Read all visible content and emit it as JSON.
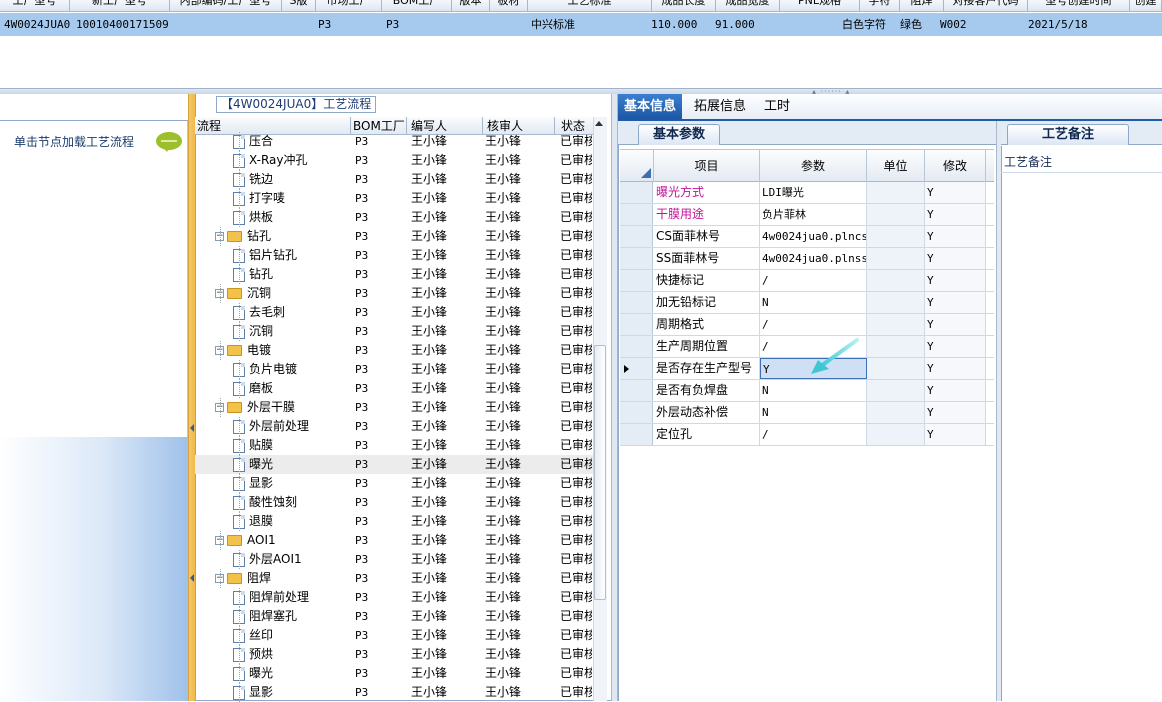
{
  "top_grid": {
    "headers": [
      "工厂型号",
      "新工厂型号",
      "内部编码/工厂型号",
      "S版",
      "市场工厂",
      "BOM工厂",
      "版本",
      "板材",
      "工艺标准",
      "成品长度",
      "成品宽度",
      "PNL规格",
      "字符",
      "阻焊",
      "对接客户代码",
      "型号创建时间",
      "创建"
    ],
    "row": {
      "model": "4W0024JUA0",
      "code": "10010400171509",
      "s_factory": "P3",
      "bom_factory": "P3",
      "standard": "中兴标准",
      "length": "110.000",
      "width": "91.000",
      "char": "白色字符",
      "mask": "绿色",
      "customer": "W002",
      "created": "2021/5/18"
    }
  },
  "left_panel": {
    "tip": "单击节点加载工艺流程",
    "tip_icon": "speech-bubble-icon"
  },
  "flow": {
    "group_title": "【4W0024JUA0】工艺流程",
    "columns": [
      "流程",
      "BOM工厂",
      "编写人",
      "核审人",
      "状态"
    ],
    "rows": [
      {
        "level": 2,
        "type": "file",
        "name": "压合",
        "factory": "P3",
        "author": "王小锋",
        "reviewer": "王小锋",
        "status": "已审核"
      },
      {
        "level": 2,
        "type": "file",
        "name": "X-Ray冲孔",
        "factory": "P3",
        "author": "王小锋",
        "reviewer": "王小锋",
        "status": "已审核"
      },
      {
        "level": 2,
        "type": "file",
        "name": "铣边",
        "factory": "P3",
        "author": "王小锋",
        "reviewer": "王小锋",
        "status": "已审核"
      },
      {
        "level": 2,
        "type": "file",
        "name": "打字唛",
        "factory": "P3",
        "author": "王小锋",
        "reviewer": "王小锋",
        "status": "已审核"
      },
      {
        "level": 2,
        "type": "file",
        "name": "烘板",
        "factory": "P3",
        "author": "王小锋",
        "reviewer": "王小锋",
        "status": "已审核"
      },
      {
        "level": 1,
        "type": "folder",
        "name": "钻孔",
        "factory": "P3",
        "author": "王小锋",
        "reviewer": "王小锋",
        "status": "已审核"
      },
      {
        "level": 2,
        "type": "file",
        "name": "铝片钻孔",
        "factory": "P3",
        "author": "王小锋",
        "reviewer": "王小锋",
        "status": "已审核"
      },
      {
        "level": 2,
        "type": "file",
        "name": "钻孔",
        "factory": "P3",
        "author": "王小锋",
        "reviewer": "王小锋",
        "status": "已审核"
      },
      {
        "level": 1,
        "type": "folder",
        "name": "沉铜",
        "factory": "P3",
        "author": "王小锋",
        "reviewer": "王小锋",
        "status": "已审核"
      },
      {
        "level": 2,
        "type": "file",
        "name": "去毛刺",
        "factory": "P3",
        "author": "王小锋",
        "reviewer": "王小锋",
        "status": "已审核"
      },
      {
        "level": 2,
        "type": "file",
        "name": "沉铜",
        "factory": "P3",
        "author": "王小锋",
        "reviewer": "王小锋",
        "status": "已审核"
      },
      {
        "level": 1,
        "type": "folder",
        "name": "电镀",
        "factory": "P3",
        "author": "王小锋",
        "reviewer": "王小锋",
        "status": "已审核"
      },
      {
        "level": 2,
        "type": "file",
        "name": "负片电镀",
        "factory": "P3",
        "author": "王小锋",
        "reviewer": "王小锋",
        "status": "已审核"
      },
      {
        "level": 2,
        "type": "file",
        "name": "磨板",
        "factory": "P3",
        "author": "王小锋",
        "reviewer": "王小锋",
        "status": "已审核"
      },
      {
        "level": 1,
        "type": "folder",
        "name": "外层干膜",
        "factory": "P3",
        "author": "王小锋",
        "reviewer": "王小锋",
        "status": "已审核"
      },
      {
        "level": 2,
        "type": "file",
        "name": "外层前处理",
        "factory": "P3",
        "author": "王小锋",
        "reviewer": "王小锋",
        "status": "已审核"
      },
      {
        "level": 2,
        "type": "file",
        "name": "贴膜",
        "factory": "P3",
        "author": "王小锋",
        "reviewer": "王小锋",
        "status": "已审核"
      },
      {
        "level": 2,
        "type": "file",
        "name": "曝光",
        "factory": "P3",
        "author": "王小锋",
        "reviewer": "王小锋",
        "status": "已审核",
        "selected": true
      },
      {
        "level": 2,
        "type": "file",
        "name": "显影",
        "factory": "P3",
        "author": "王小锋",
        "reviewer": "王小锋",
        "status": "已审核"
      },
      {
        "level": 2,
        "type": "file",
        "name": "酸性蚀刻",
        "factory": "P3",
        "author": "王小锋",
        "reviewer": "王小锋",
        "status": "已审核"
      },
      {
        "level": 2,
        "type": "file",
        "name": "退膜",
        "factory": "P3",
        "author": "王小锋",
        "reviewer": "王小锋",
        "status": "已审核"
      },
      {
        "level": 1,
        "type": "folder",
        "name": "AOI1",
        "factory": "P3",
        "author": "王小锋",
        "reviewer": "王小锋",
        "status": "已审核"
      },
      {
        "level": 2,
        "type": "file",
        "name": "外层AOI1",
        "factory": "P3",
        "author": "王小锋",
        "reviewer": "王小锋",
        "status": "已审核"
      },
      {
        "level": 1,
        "type": "folder",
        "name": "阻焊",
        "factory": "P3",
        "author": "王小锋",
        "reviewer": "王小锋",
        "status": "已审核"
      },
      {
        "level": 2,
        "type": "file",
        "name": "阻焊前处理",
        "factory": "P3",
        "author": "王小锋",
        "reviewer": "王小锋",
        "status": "已审核"
      },
      {
        "level": 2,
        "type": "file",
        "name": "阻焊塞孔",
        "factory": "P3",
        "author": "王小锋",
        "reviewer": "王小锋",
        "status": "已审核"
      },
      {
        "level": 2,
        "type": "file",
        "name": "丝印",
        "factory": "P3",
        "author": "王小锋",
        "reviewer": "王小锋",
        "status": "已审核"
      },
      {
        "level": 2,
        "type": "file",
        "name": "预烘",
        "factory": "P3",
        "author": "王小锋",
        "reviewer": "王小锋",
        "status": "已审核"
      },
      {
        "level": 2,
        "type": "file",
        "name": "曝光",
        "factory": "P3",
        "author": "王小锋",
        "reviewer": "王小锋",
        "status": "已审核"
      },
      {
        "level": 2,
        "type": "file",
        "name": "显影",
        "factory": "P3",
        "author": "王小锋",
        "reviewer": "王小锋",
        "status": "已审核"
      }
    ]
  },
  "tabs": [
    "基本信息",
    "拓展信息",
    "工时"
  ],
  "params": {
    "subtab": "基本参数",
    "columns": [
      "项目",
      "参数",
      "单位",
      "修改"
    ],
    "rows": [
      {
        "item": "曝光方式",
        "value": "LDI曝光",
        "unit": "",
        "mod": "Y",
        "highlight": true
      },
      {
        "item": "干膜用途",
        "value": "负片菲林",
        "unit": "",
        "mod": "Y",
        "highlight": true
      },
      {
        "item": "CS面菲林号",
        "value": "4w0024jua0.plncs",
        "unit": "",
        "mod": "Y"
      },
      {
        "item": "SS面菲林号",
        "value": "4w0024jua0.plnss",
        "unit": "",
        "mod": "Y"
      },
      {
        "item": "快捷标记",
        "value": "/",
        "unit": "",
        "mod": "Y"
      },
      {
        "item": "加无铅标记",
        "value": "N",
        "unit": "",
        "mod": "Y"
      },
      {
        "item": "周期格式",
        "value": "/",
        "unit": "",
        "mod": "Y"
      },
      {
        "item": "生产周期位置",
        "value": "/",
        "unit": "",
        "mod": "Y"
      },
      {
        "item": "是否存在生产型号",
        "value": "Y",
        "unit": "",
        "mod": "Y",
        "current": true
      },
      {
        "item": "是否有负焊盘",
        "value": "N",
        "unit": "",
        "mod": "Y"
      },
      {
        "item": "外层动态补偿",
        "value": "N",
        "unit": "",
        "mod": "Y"
      },
      {
        "item": "定位孔",
        "value": "/",
        "unit": "",
        "mod": "Y"
      }
    ]
  },
  "notes": {
    "tab": "工艺备注",
    "label": "工艺备注"
  },
  "colors": {
    "accent": "#1e5ba8",
    "highlight_text": "#c0159a",
    "arrow": "#4fd3d8",
    "splitter": "#f1b94a"
  }
}
